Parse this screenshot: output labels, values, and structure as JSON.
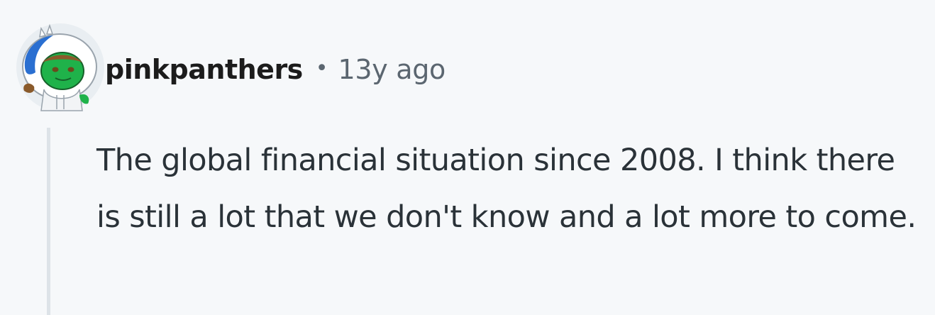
{
  "comment": {
    "author": {
      "username": "pinkpanthers",
      "avatar_icon": "snoo-avatar-icon"
    },
    "separator": "•",
    "timestamp": "13y ago",
    "body": "The global financial situation since 2008. I think there is still a lot that we don't know and a lot more to come."
  },
  "colors": {
    "background": "#f6f8fa",
    "username": "#1c1c1c",
    "meta_text": "#5b6670",
    "body_text": "#2a3238",
    "thread_line": "#dde3e8",
    "avatar_green": "#1fb24a",
    "avatar_blue": "#2a6fd1"
  }
}
